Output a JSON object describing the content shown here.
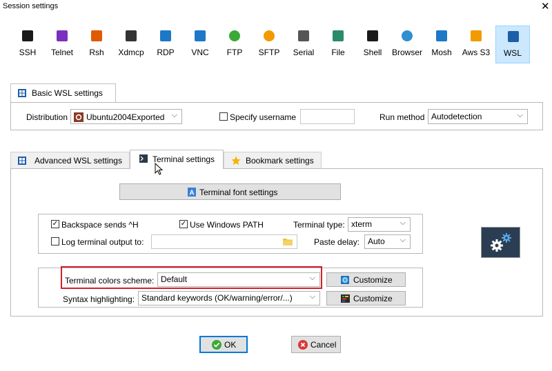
{
  "window": {
    "title": "Session settings",
    "close_glyph": "✕"
  },
  "session_types": [
    {
      "label": "SSH",
      "icon": "key-icon",
      "color": "#1a1a1a"
    },
    {
      "label": "Telnet",
      "icon": "telnet-icon",
      "color": "#7b2fbe"
    },
    {
      "label": "Rsh",
      "icon": "rsh-icon",
      "color": "#e05a00"
    },
    {
      "label": "Xdmcp",
      "icon": "xdmcp-icon",
      "color": "#333333"
    },
    {
      "label": "RDP",
      "icon": "rdp-icon",
      "color": "#1e78c8"
    },
    {
      "label": "VNC",
      "icon": "vnc-icon",
      "color": "#1e78c8"
    },
    {
      "label": "FTP",
      "icon": "ftp-icon",
      "color": "#3aa935"
    },
    {
      "label": "SFTP",
      "icon": "sftp-icon",
      "color": "#f29a00"
    },
    {
      "label": "Serial",
      "icon": "serial-icon",
      "color": "#555555"
    },
    {
      "label": "File",
      "icon": "file-icon",
      "color": "#2a8a6a"
    },
    {
      "label": "Shell",
      "icon": "shell-icon",
      "color": "#1a1a1a"
    },
    {
      "label": "Browser",
      "icon": "browser-icon",
      "color": "#2f8fd0"
    },
    {
      "label": "Mosh",
      "icon": "mosh-icon",
      "color": "#1e78c8"
    },
    {
      "label": "Aws S3",
      "icon": "aws-s3-icon",
      "color": "#f29a00"
    },
    {
      "label": "WSL",
      "icon": "wsl-icon",
      "color": "#1e5ea8",
      "active": true
    }
  ],
  "basic_tab": {
    "label": "Basic WSL settings"
  },
  "basic": {
    "distribution_label": "Distribution",
    "distribution_value": "Ubuntu2004Exported",
    "specify_username_label": "Specify username",
    "specify_username_checked": false,
    "username_value": "",
    "run_method_label": "Run method",
    "run_method_value": "Autodetection"
  },
  "tabs": [
    {
      "label": "Advanced WSL settings",
      "selected": false
    },
    {
      "label": "Terminal settings",
      "selected": true
    },
    {
      "label": "Bookmark settings",
      "selected": false
    }
  ],
  "terminal": {
    "font_button": "Terminal font settings",
    "backspace_label": "Backspace sends ^H",
    "backspace_checked": true,
    "use_windows_path_label": "Use Windows PATH",
    "use_windows_path_checked": true,
    "terminal_type_label": "Terminal type:",
    "terminal_type_value": "xterm",
    "log_output_label": "Log terminal output to:",
    "log_output_checked": false,
    "log_output_value": "",
    "paste_delay_label": "Paste delay:",
    "paste_delay_value": "Auto",
    "colors_scheme_label": "Terminal colors scheme:",
    "colors_scheme_value": "Default",
    "customize_label": "Customize",
    "syntax_label": "Syntax highlighting:",
    "syntax_value": "Standard keywords (OK/warning/error/...)",
    "customize2_label": "Customize"
  },
  "footer": {
    "ok_label": "OK",
    "cancel_label": "Cancel"
  },
  "colors": {
    "highlight_red": "#d0202a",
    "active_tile": "#cce8ff",
    "ok_green": "#3aa935",
    "cancel_red": "#d93838"
  }
}
